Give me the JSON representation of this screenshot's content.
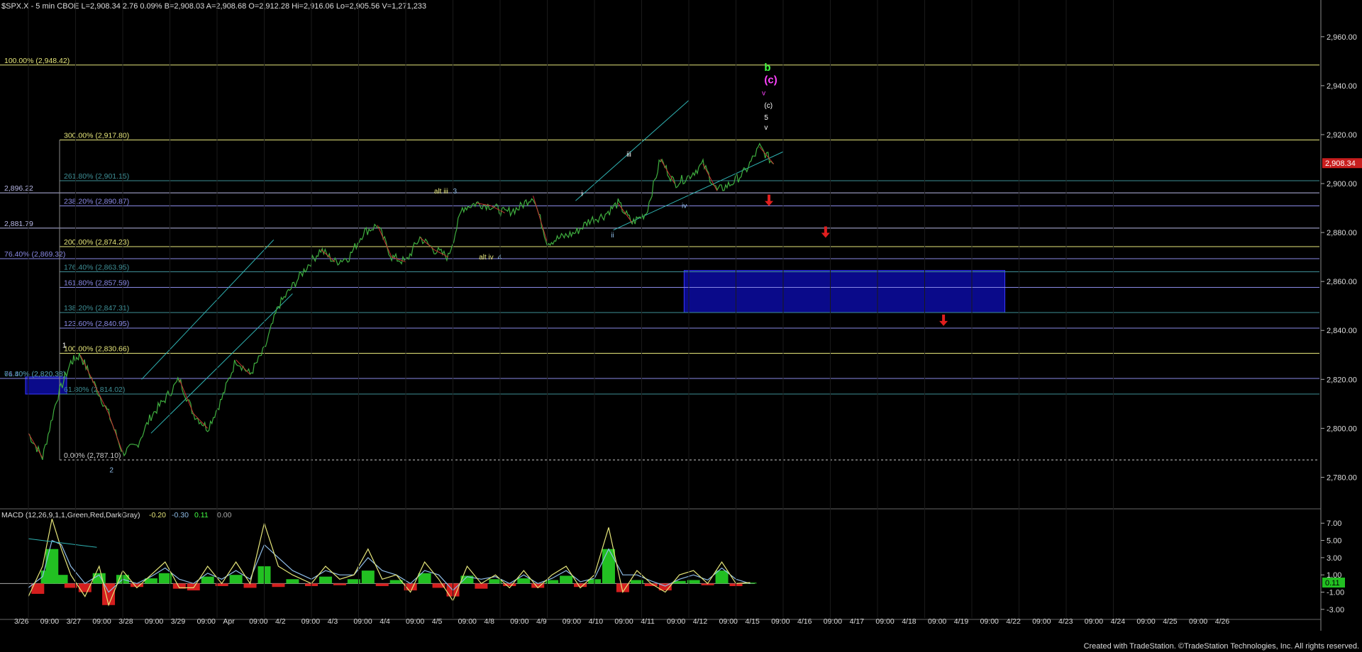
{
  "header": {
    "text": "$SPX.X - 5 min  CBOE  L=2,908.34  2.76  0.09%  B=2,908.03  A=2,908.68  O=2,912.28  Hi=2,916.06  Lo=2,905.56  V=1,271,233"
  },
  "footer": {
    "text": "Created with TradeStation. ©TradeStation Technologies, Inc. All rights reserved."
  },
  "chart_data": {
    "type": "line",
    "price_axis": {
      "ylim": [
        2770,
        2975
      ],
      "ticks": [
        "2,780.00",
        "2,800.00",
        "2,820.00",
        "2,840.00",
        "2,860.00",
        "2,880.00",
        "2,900.00",
        "2,920.00",
        "2,940.00",
        "2,960.00"
      ],
      "tick_values": [
        2780,
        2800,
        2820,
        2840,
        2860,
        2880,
        2900,
        2920,
        2940,
        2960
      ]
    },
    "last_price_label": "2,908.34",
    "last_price": 2908.34,
    "x_axis": {
      "labels": [
        "3/26",
        "09:00",
        "3/27",
        "09:00",
        "3/28",
        "09:00",
        "3/29",
        "09:00",
        "Apr",
        "09:00",
        "4/2",
        "09:00",
        "4/3",
        "09:00",
        "4/4",
        "09:00",
        "4/5",
        "09:00",
        "4/8",
        "09:00",
        "4/9",
        "09:00",
        "4/10",
        "09:00",
        "4/11",
        "09:00",
        "4/12",
        "09:00",
        "4/15",
        "09:00",
        "4/16",
        "09:00",
        "4/17",
        "09:00",
        "4/18",
        "09:00",
        "4/19",
        "09:00",
        "4/22",
        "09:00",
        "4/23",
        "09:00",
        "4/24",
        "09:00",
        "4/25",
        "09:00",
        "4/26"
      ],
      "sessions": [
        "3/26",
        "3/27",
        "3/28",
        "3/29",
        "Apr",
        "4/2",
        "4/3",
        "4/4",
        "4/5",
        "4/8",
        "4/9",
        "4/10",
        "4/11",
        "4/12",
        "4/15",
        "4/16",
        "4/17",
        "4/18",
        "4/19",
        "4/22",
        "4/23",
        "4/24",
        "4/25",
        "4/26"
      ]
    },
    "price_series": {
      "name": "$SPX.X",
      "x": [
        0,
        0.3,
        0.6,
        0.9,
        1.1,
        1.4,
        1.7,
        2.0,
        2.3,
        2.6,
        2.9,
        3.2,
        3.5,
        3.8,
        4.1,
        4.4,
        4.7,
        5.0,
        5.3,
        5.6,
        5.9,
        6.2,
        6.5,
        6.8,
        7.1,
        7.4,
        7.7,
        8.0,
        8.3,
        8.6,
        8.9,
        9.2,
        9.5,
        9.8,
        10.1,
        10.4,
        10.7,
        11.0,
        11.3,
        11.6,
        11.9,
        12.2,
        12.5,
        12.8,
        13.1,
        13.4,
        13.7,
        14.0,
        14.3,
        14.6,
        14.9,
        15.2,
        15.5,
        15.8
      ],
      "y": [
        2798,
        2788,
        2812,
        2827,
        2830,
        2818,
        2806,
        2790,
        2793,
        2805,
        2812,
        2820,
        2806,
        2800,
        2812,
        2828,
        2822,
        2832,
        2850,
        2858,
        2866,
        2873,
        2868,
        2870,
        2880,
        2883,
        2870,
        2868,
        2878,
        2873,
        2870,
        2890,
        2892,
        2891,
        2888,
        2890,
        2895,
        2876,
        2878,
        2880,
        2885,
        2887,
        2892,
        2884,
        2888,
        2910,
        2900,
        2903,
        2908,
        2897,
        2900,
        2905,
        2915,
        2908
      ]
    },
    "fib_levels": [
      {
        "label": "100.00% (2,948.42)",
        "value": 2948.42,
        "color": "#e6e67a",
        "start": "left"
      },
      {
        "label": "300.00% (2,917.80)",
        "value": 2917.8,
        "color": "#e6e67a",
        "start": "mid"
      },
      {
        "label": "261.80% (2,901.15)",
        "value": 2901.15,
        "color": "#3e8f96",
        "start": "mid"
      },
      {
        "label": "2,896.22",
        "value": 2896.22,
        "color": "#b8b8e6",
        "start": "left"
      },
      {
        "label": "238.20% (2,890.87)",
        "value": 2890.87,
        "color": "#8a8ae6",
        "start": "mid"
      },
      {
        "label": "2,881.79",
        "value": 2881.79,
        "color": "#b8b8e6",
        "start": "left"
      },
      {
        "label": "200.00% (2,874.23)",
        "value": 2874.23,
        "color": "#e6e67a",
        "start": "mid"
      },
      {
        "label": "76.40% (2,869.32)",
        "value": 2869.32,
        "color": "#8a8ae6",
        "start": "left"
      },
      {
        "label": "176.40% (2,863.95)",
        "value": 2863.95,
        "color": "#3e8f96",
        "start": "mid"
      },
      {
        "label": "161.80% (2,857.59)",
        "value": 2857.59,
        "color": "#8a8ae6",
        "start": "mid"
      },
      {
        "label": "138.20% (2,847.31)",
        "value": 2847.31,
        "color": "#3e8f96",
        "start": "mid"
      },
      {
        "label": "123.60% (2,840.95)",
        "value": 2840.95,
        "color": "#8a8ae6",
        "start": "mid"
      },
      {
        "label": "100.00% (2,830.66)",
        "value": 2830.66,
        "color": "#e6e67a",
        "start": "mid"
      },
      {
        "label": "76.40% (2,820.38)",
        "value": 2820.38,
        "color": "#8a8ae6",
        "start": "left"
      },
      {
        "label": "61.80% (2,814.02)",
        "value": 2814.02,
        "color": "#3e8f96",
        "start": "mid"
      },
      {
        "label": "0.00% (2,787.10)",
        "value": 2787.1,
        "color": "#cccccc",
        "start": "mid",
        "dashed": true
      }
    ],
    "extra_label": {
      "text": "61.80% (2,820.38)",
      "value": 2820.38
    },
    "target_box": {
      "x0": 13.9,
      "x1": 20.7,
      "y0": 2847.31,
      "y1": 2864.5
    },
    "channel_lines": [
      {
        "x": [
          2.4,
          5.2
        ],
        "y": [
          2820,
          2877
        ]
      },
      {
        "x": [
          2.6,
          5.6
        ],
        "y": [
          2798,
          2855
        ]
      },
      {
        "x": [
          11.6,
          14.0
        ],
        "y": [
          2893,
          2934
        ]
      },
      {
        "x": [
          12.4,
          16.0
        ],
        "y": [
          2881,
          2913
        ]
      }
    ],
    "wave_labels": [
      {
        "text": "1",
        "x": 0.72,
        "y": 2833,
        "color": "#ffffff"
      },
      {
        "text": "2",
        "x": 1.72,
        "y": 2782,
        "color": "#8fbde8"
      },
      {
        "text": "alt iii",
        "x": 8.6,
        "y": 2896,
        "color": "#e6e67a"
      },
      {
        "text": "3",
        "x": 9.0,
        "y": 2896,
        "color": "#8fbde8"
      },
      {
        "text": "alt iv",
        "x": 9.55,
        "y": 2869,
        "color": "#e6e67a"
      },
      {
        "text": "4",
        "x": 9.95,
        "y": 2869,
        "color": "#8fbde8"
      },
      {
        "text": "i",
        "x": 11.72,
        "y": 2895,
        "color": "#ffffff"
      },
      {
        "text": "ii",
        "x": 12.35,
        "y": 2878,
        "color": "#8fbde8"
      },
      {
        "text": "iii",
        "x": 12.68,
        "y": 2911,
        "color": "#ffffff"
      },
      {
        "text": "iv",
        "x": 13.85,
        "y": 2890,
        "color": "#8fbde8"
      },
      {
        "text": "v",
        "x": 15.6,
        "y": 2922,
        "color": "#ffffff"
      },
      {
        "text": "5",
        "x": 15.6,
        "y": 2926,
        "color": "#ffffff"
      },
      {
        "text": "(c)",
        "x": 15.6,
        "y": 2931,
        "color": "#ffffff"
      },
      {
        "text": "v",
        "x": 15.55,
        "y": 2936,
        "color": "#ff44ff"
      },
      {
        "text": "(c)",
        "x": 15.6,
        "y": 2941,
        "color": "#ff44ff"
      },
      {
        "text": "b",
        "x": 15.6,
        "y": 2946,
        "color": "#44ff44"
      }
    ],
    "arrows": [
      {
        "x": 15.7,
        "y": 2892
      },
      {
        "x": 16.9,
        "y": 2879
      },
      {
        "x": 19.4,
        "y": 2843
      }
    ],
    "macd": {
      "label": "MACD (12,26,9,1,1,Green,Red,DarkGray)",
      "values_text": [
        "-0.20",
        "-0.30",
        "0.11",
        "0.00"
      ],
      "value_colors": [
        "#e6e67a",
        "#8fbde8",
        "#44ff44",
        "#aaaaaa"
      ],
      "ticks": [
        "7.00",
        "5.00",
        "3.00",
        "1.00",
        "-1.00",
        "-3.00"
      ],
      "tick_values": [
        7,
        5,
        3,
        1,
        -1,
        -3
      ],
      "ylim": [
        -4,
        8.5
      ],
      "last_value_label": "0.11",
      "histogram": {
        "x": [
          0.2,
          0.4,
          0.5,
          0.7,
          0.9,
          1.2,
          1.5,
          1.7,
          2.0,
          2.3,
          2.6,
          2.9,
          3.2,
          3.5,
          3.8,
          4.1,
          4.4,
          4.7,
          5.0,
          5.3,
          5.6,
          6.0,
          6.3,
          6.6,
          6.9,
          7.2,
          7.5,
          7.8,
          8.1,
          8.4,
          8.7,
          9.0,
          9.3,
          9.6,
          9.9,
          10.2,
          10.5,
          10.8,
          11.1,
          11.4,
          11.7,
          12.0,
          12.3,
          12.6,
          12.9,
          13.2,
          13.5,
          13.8,
          14.1,
          14.4,
          14.7,
          15.0,
          15.3
        ],
        "y": [
          -1.2,
          1.5,
          4.0,
          1.0,
          -0.5,
          -1.0,
          1.2,
          -2.5,
          1.0,
          -0.4,
          0.6,
          1.2,
          -0.6,
          -0.8,
          0.8,
          -0.3,
          1.0,
          -0.5,
          2.0,
          -0.4,
          0.5,
          -0.3,
          0.8,
          -0.2,
          0.5,
          1.5,
          -0.3,
          0.4,
          -0.8,
          1.2,
          -0.5,
          -1.5,
          0.9,
          -0.6,
          0.5,
          -0.3,
          0.6,
          -0.5,
          0.4,
          0.9,
          -0.4,
          0.5,
          4.0,
          -1.0,
          0.4,
          -0.3,
          -0.8,
          0.3,
          0.4,
          -0.2,
          1.5,
          -0.3,
          0.1
        ]
      },
      "macd_line": {
        "x": [
          0.0,
          0.3,
          0.5,
          0.7,
          0.9,
          1.2,
          1.5,
          1.7,
          2.0,
          2.3,
          2.6,
          2.9,
          3.2,
          3.5,
          3.8,
          4.1,
          4.4,
          4.7,
          5.0,
          5.3,
          5.6,
          6.0,
          6.3,
          6.6,
          6.9,
          7.2,
          7.5,
          7.8,
          8.1,
          8.4,
          8.7,
          9.0,
          9.3,
          9.6,
          9.9,
          10.2,
          10.5,
          10.8,
          11.1,
          11.4,
          11.7,
          12.0,
          12.3,
          12.6,
          12.9,
          13.2,
          13.5,
          13.8,
          14.1,
          14.4,
          14.7,
          15.0,
          15.3
        ],
        "y": [
          -1.5,
          2.0,
          7.5,
          4.0,
          1.0,
          -1.5,
          2.0,
          -2.5,
          1.5,
          -0.5,
          1.0,
          2.5,
          -0.5,
          -0.5,
          2.0,
          0.0,
          2.5,
          0.0,
          7.0,
          2.0,
          1.0,
          0.0,
          2.0,
          0.5,
          1.0,
          4.0,
          0.5,
          1.0,
          -1.0,
          2.5,
          0.5,
          -2.0,
          2.0,
          0.0,
          1.0,
          -0.5,
          1.5,
          -0.5,
          1.0,
          2.0,
          -0.5,
          1.0,
          6.5,
          -1.0,
          1.5,
          0.0,
          -1.0,
          1.0,
          1.5,
          0.0,
          2.5,
          0.0,
          0.11
        ]
      },
      "signal_line": {
        "x": [
          0.0,
          0.3,
          0.5,
          0.7,
          0.9,
          1.2,
          1.5,
          1.7,
          2.0,
          2.3,
          2.6,
          2.9,
          3.2,
          3.5,
          3.8,
          4.1,
          4.4,
          4.7,
          5.0,
          5.3,
          5.6,
          6.0,
          6.3,
          6.6,
          6.9,
          7.2,
          7.5,
          7.8,
          8.1,
          8.4,
          8.7,
          9.0,
          9.3,
          9.6,
          9.9,
          10.2,
          10.5,
          10.8,
          11.1,
          11.4,
          11.7,
          12.0,
          12.3,
          12.6,
          12.9,
          13.2,
          13.5,
          13.8,
          14.1,
          14.4,
          14.7,
          15.0,
          15.3
        ],
        "y": [
          -0.5,
          0.8,
          5.0,
          4.5,
          2.0,
          0.0,
          1.0,
          -1.0,
          0.5,
          0.0,
          0.8,
          1.8,
          0.5,
          0.0,
          1.2,
          0.5,
          1.5,
          0.5,
          4.5,
          3.0,
          1.5,
          0.5,
          1.5,
          1.0,
          1.0,
          3.0,
          1.5,
          1.0,
          0.0,
          1.5,
          1.0,
          -0.8,
          0.8,
          0.5,
          0.8,
          0.0,
          1.0,
          0.0,
          0.6,
          1.5,
          0.2,
          0.6,
          4.0,
          1.0,
          1.0,
          0.3,
          -0.3,
          0.5,
          1.0,
          0.4,
          1.8,
          0.5,
          0.0
        ]
      },
      "trend_line": {
        "x": [
          0.0,
          1.45
        ],
        "y": [
          5.2,
          4.2
        ]
      }
    }
  }
}
